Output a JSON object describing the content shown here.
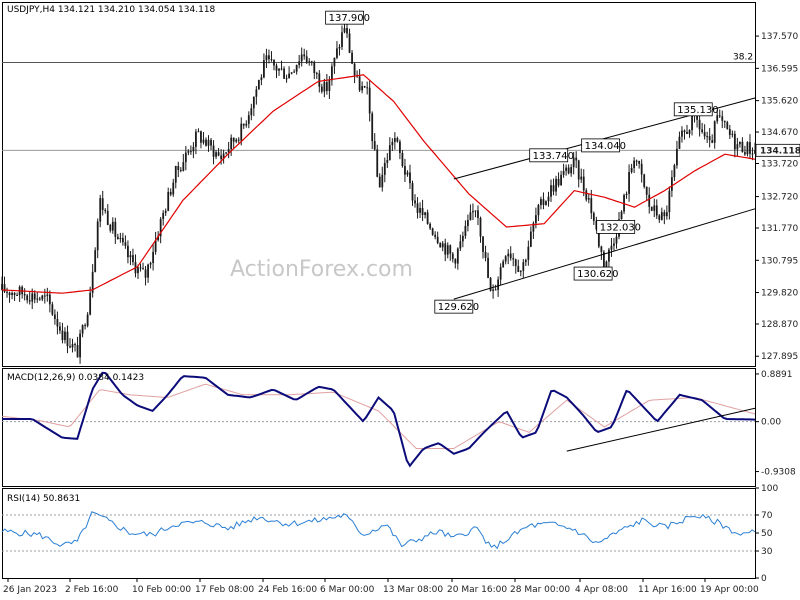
{
  "colors": {
    "candle": "#1a1a1a",
    "ma": "#e00000",
    "trendline": "#000000",
    "hline": "#555555",
    "macd": "#0b0b7a",
    "signal": "#e0a0a0",
    "rsi": "#2a7fd4",
    "grid": "#9aa0a6",
    "price_box": "#ffffff"
  },
  "chart_data": [
    {
      "type": "candlestick",
      "title": "USDJPY,H4  134.121 134.210 134.054 134.118",
      "ylim": [
        127.6,
        138.6
      ],
      "y_ticks": [
        "137.570",
        "136.595",
        "135.620",
        "134.670",
        "133.720",
        "132.720",
        "131.770",
        "130.795",
        "129.820",
        "128.870",
        "127.895"
      ],
      "current_price": "134.118",
      "fib_label": "38.2",
      "fib_level": 136.77,
      "annotations": [
        {
          "text": "137.900",
          "x": 0.455,
          "y": 137.9
        },
        {
          "text": "129.620",
          "x": 0.6,
          "y": 129.62
        },
        {
          "text": "133.740",
          "x": 0.726,
          "y": 133.74
        },
        {
          "text": "130.620",
          "x": 0.785,
          "y": 130.62
        },
        {
          "text": "132.030",
          "x": 0.815,
          "y": 132.03
        },
        {
          "text": "134.040",
          "x": 0.795,
          "y": 134.04
        },
        {
          "text": "135.130",
          "x": 0.918,
          "y": 135.13
        }
      ],
      "waypoints": [
        [
          0.0,
          129.9
        ],
        [
          0.03,
          129.8
        ],
        [
          0.06,
          129.6
        ],
        [
          0.08,
          128.6
        ],
        [
          0.1,
          128.0
        ],
        [
          0.115,
          129.5
        ],
        [
          0.13,
          132.6
        ],
        [
          0.15,
          131.6
        ],
        [
          0.17,
          130.8
        ],
        [
          0.19,
          130.3
        ],
        [
          0.21,
          131.9
        ],
        [
          0.23,
          133.4
        ],
        [
          0.26,
          134.6
        ],
        [
          0.29,
          133.9
        ],
        [
          0.32,
          134.8
        ],
        [
          0.35,
          136.8
        ],
        [
          0.38,
          136.4
        ],
        [
          0.4,
          137.1
        ],
        [
          0.43,
          135.9
        ],
        [
          0.455,
          137.9
        ],
        [
          0.47,
          136.2
        ],
        [
          0.485,
          135.8
        ],
        [
          0.5,
          133.0
        ],
        [
          0.52,
          134.6
        ],
        [
          0.55,
          132.4
        ],
        [
          0.57,
          131.8
        ],
        [
          0.6,
          130.8
        ],
        [
          0.63,
          132.5
        ],
        [
          0.65,
          129.62
        ],
        [
          0.67,
          131.2
        ],
        [
          0.69,
          130.5
        ],
        [
          0.71,
          132.2
        ],
        [
          0.73,
          133.0
        ],
        [
          0.76,
          133.74
        ],
        [
          0.78,
          132.6
        ],
        [
          0.8,
          130.62
        ],
        [
          0.82,
          132.0
        ],
        [
          0.84,
          134.04
        ],
        [
          0.86,
          132.4
        ],
        [
          0.88,
          132.03
        ],
        [
          0.9,
          134.4
        ],
        [
          0.92,
          135.13
        ],
        [
          0.94,
          134.2
        ],
        [
          0.95,
          135.1
        ],
        [
          0.975,
          134.3
        ],
        [
          1.0,
          134.118
        ]
      ],
      "ma_waypoints": [
        [
          0.0,
          129.9
        ],
        [
          0.08,
          129.8
        ],
        [
          0.12,
          129.9
        ],
        [
          0.18,
          130.6
        ],
        [
          0.24,
          132.6
        ],
        [
          0.3,
          134.0
        ],
        [
          0.36,
          135.3
        ],
        [
          0.42,
          136.2
        ],
        [
          0.48,
          136.4
        ],
        [
          0.52,
          135.6
        ],
        [
          0.56,
          134.4
        ],
        [
          0.62,
          132.8
        ],
        [
          0.67,
          131.8
        ],
        [
          0.72,
          131.9
        ],
        [
          0.76,
          132.9
        ],
        [
          0.8,
          132.7
        ],
        [
          0.84,
          132.4
        ],
        [
          0.88,
          132.9
        ],
        [
          0.92,
          133.5
        ],
        [
          0.96,
          134.0
        ],
        [
          1.0,
          133.85
        ]
      ],
      "trendlines": [
        [
          [
            0.6,
            129.62
          ],
          [
            1.0,
            132.35
          ]
        ],
        [
          [
            0.6,
            133.25
          ],
          [
            1.0,
            135.7
          ]
        ]
      ]
    },
    {
      "type": "line",
      "title": "MACD(12,26,9) 0.0384 0.1423",
      "ylim": [
        -1.2,
        1.0
      ],
      "y_ticks": [
        "0.8891",
        "0.00",
        "-0.9308"
      ],
      "macd": [
        [
          0.0,
          0.05
        ],
        [
          0.04,
          0.05
        ],
        [
          0.08,
          -0.3
        ],
        [
          0.1,
          -0.32
        ],
        [
          0.12,
          0.6
        ],
        [
          0.135,
          0.95
        ],
        [
          0.16,
          0.5
        ],
        [
          0.18,
          0.3
        ],
        [
          0.2,
          0.2
        ],
        [
          0.22,
          0.5
        ],
        [
          0.24,
          0.85
        ],
        [
          0.27,
          0.82
        ],
        [
          0.3,
          0.5
        ],
        [
          0.33,
          0.45
        ],
        [
          0.36,
          0.6
        ],
        [
          0.39,
          0.4
        ],
        [
          0.42,
          0.65
        ],
        [
          0.44,
          0.6
        ],
        [
          0.46,
          0.3
        ],
        [
          0.48,
          0.0
        ],
        [
          0.5,
          0.45
        ],
        [
          0.52,
          0.2
        ],
        [
          0.54,
          -0.85
        ],
        [
          0.56,
          -0.5
        ],
        [
          0.58,
          -0.4
        ],
        [
          0.6,
          -0.6
        ],
        [
          0.62,
          -0.5
        ],
        [
          0.64,
          -0.2
        ],
        [
          0.67,
          0.2
        ],
        [
          0.69,
          -0.3
        ],
        [
          0.71,
          -0.2
        ],
        [
          0.73,
          0.6
        ],
        [
          0.75,
          0.45
        ],
        [
          0.77,
          0.15
        ],
        [
          0.79,
          -0.2
        ],
        [
          0.81,
          -0.1
        ],
        [
          0.83,
          0.6
        ],
        [
          0.85,
          0.3
        ],
        [
          0.87,
          0.0
        ],
        [
          0.9,
          0.5
        ],
        [
          0.93,
          0.4
        ],
        [
          0.96,
          0.05
        ],
        [
          1.0,
          0.0384
        ]
      ],
      "signal": [
        [
          0.0,
          0.1
        ],
        [
          0.05,
          0.02
        ],
        [
          0.09,
          -0.1
        ],
        [
          0.13,
          0.6
        ],
        [
          0.17,
          0.5
        ],
        [
          0.22,
          0.45
        ],
        [
          0.27,
          0.7
        ],
        [
          0.32,
          0.5
        ],
        [
          0.38,
          0.5
        ],
        [
          0.44,
          0.55
        ],
        [
          0.5,
          0.2
        ],
        [
          0.55,
          -0.5
        ],
        [
          0.6,
          -0.5
        ],
        [
          0.66,
          0.0
        ],
        [
          0.7,
          -0.2
        ],
        [
          0.75,
          0.4
        ],
        [
          0.8,
          -0.1
        ],
        [
          0.86,
          0.4
        ],
        [
          0.92,
          0.45
        ],
        [
          1.0,
          0.1423
        ]
      ],
      "trendline": [
        [
          0.75,
          -0.55
        ],
        [
          1.0,
          0.25
        ]
      ]
    },
    {
      "type": "line",
      "title": "RSI(14) 50.8631",
      "ylim": [
        0,
        100
      ],
      "y_ticks": [
        "100",
        "70",
        "50",
        "30",
        "0"
      ],
      "rsi": [
        [
          0.0,
          52
        ],
        [
          0.05,
          48
        ],
        [
          0.08,
          36
        ],
        [
          0.1,
          40
        ],
        [
          0.12,
          72
        ],
        [
          0.14,
          64
        ],
        [
          0.17,
          50
        ],
        [
          0.2,
          48
        ],
        [
          0.23,
          60
        ],
        [
          0.27,
          62
        ],
        [
          0.3,
          55
        ],
        [
          0.34,
          68
        ],
        [
          0.38,
          60
        ],
        [
          0.42,
          64
        ],
        [
          0.455,
          70
        ],
        [
          0.48,
          48
        ],
        [
          0.51,
          60
        ],
        [
          0.53,
          36
        ],
        [
          0.55,
          42
        ],
        [
          0.58,
          52
        ],
        [
          0.6,
          44
        ],
        [
          0.63,
          56
        ],
        [
          0.65,
          32
        ],
        [
          0.68,
          48
        ],
        [
          0.7,
          58
        ],
        [
          0.73,
          60
        ],
        [
          0.76,
          54
        ],
        [
          0.79,
          38
        ],
        [
          0.82,
          52
        ],
        [
          0.85,
          64
        ],
        [
          0.88,
          56
        ],
        [
          0.92,
          70
        ],
        [
          0.95,
          62
        ],
        [
          0.98,
          48
        ],
        [
          1.0,
          50.86
        ]
      ]
    }
  ],
  "x_labels": [
    "26 Jan 2023",
    "2 Feb 16:00",
    "10 Feb 00:00",
    "17 Feb 08:00",
    "24 Feb 16:00",
    "6 Mar 00:00",
    "13 Mar 08:00",
    "20 Mar 16:00",
    "28 Mar 00:00",
    "4 Apr 08:00",
    "11 Apr 16:00",
    "19 Apr 00:00"
  ],
  "watermark": "ActionForex.com"
}
